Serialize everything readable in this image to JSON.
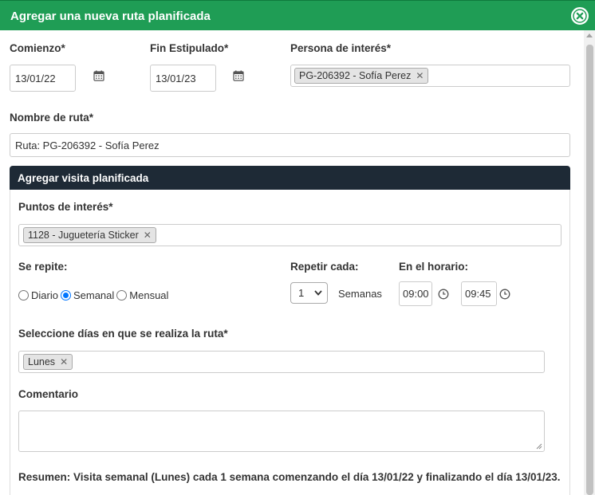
{
  "modal": {
    "title": "Agregar una nueva ruta planificada",
    "close_icon": "close-circle-icon"
  },
  "form": {
    "start": {
      "label": "Comienzo*",
      "value": "13/01/22"
    },
    "end": {
      "label": "Fin Estipulado*",
      "value": "13/01/23"
    },
    "person": {
      "label": "Persona de interés*",
      "tags": [
        "PG-206392 - Sofía Perez"
      ]
    },
    "route_name": {
      "label": "Nombre de ruta*",
      "value": "Ruta: PG-206392 - Sofía Perez"
    }
  },
  "visit_panel": {
    "title": "Agregar visita planificada",
    "points": {
      "label": "Puntos de interés*",
      "tags": [
        "1128 - Juguetería Sticker"
      ]
    },
    "repeat": {
      "label": "Se repite:",
      "options": [
        "Diario",
        "Semanal",
        "Mensual"
      ],
      "selected": "Semanal"
    },
    "repeat_every": {
      "label": "Repetir cada:",
      "value": "1",
      "unit": "Semanas"
    },
    "schedule": {
      "label": "En el horario:",
      "from": "09:00",
      "to": "09:45"
    },
    "days": {
      "label": "Seleccione días en que se realiza la ruta*",
      "tags": [
        "Lunes"
      ]
    },
    "comment": {
      "label": "Comentario",
      "value": ""
    },
    "summary": "Resumen: Visita semanal (Lunes) cada 1 semana comenzando el día 13/01/22 y finalizando el día 13/01/23."
  },
  "colors": {
    "header": "#1f9d55",
    "panel_header": "#1e2a36",
    "radio_accent": "#0075ff"
  }
}
